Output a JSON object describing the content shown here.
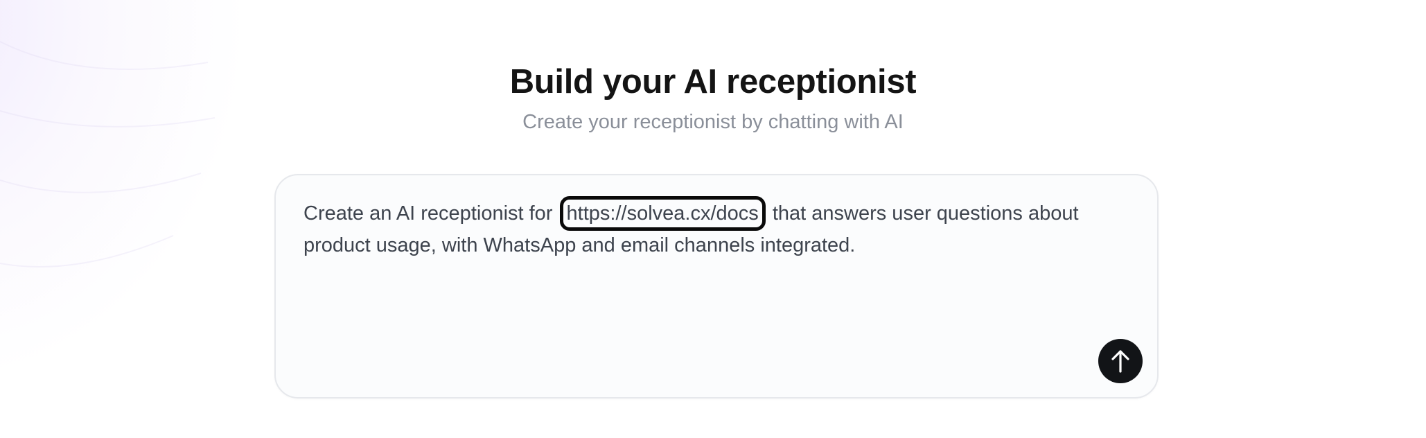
{
  "header": {
    "title": "Build your AI receptionist",
    "subtitle": "Create your receptionist by chatting with AI"
  },
  "prompt": {
    "text_before": "Create an AI receptionist for ",
    "link": "https://solvea.cx/docs",
    "text_after": " that answers user questions about product usage, with WhatsApp and email channels integrated."
  },
  "send_button": {
    "icon": "arrow-up-icon"
  },
  "colors": {
    "title": "#141414",
    "subtitle": "#8a8f99",
    "body_text": "#3d434d",
    "card_background": "#fbfcfd",
    "card_border": "#e6e8ec",
    "send_button": "#121417",
    "highlight_border": "#0a0a0a",
    "background_glow": "#ece4fc"
  }
}
